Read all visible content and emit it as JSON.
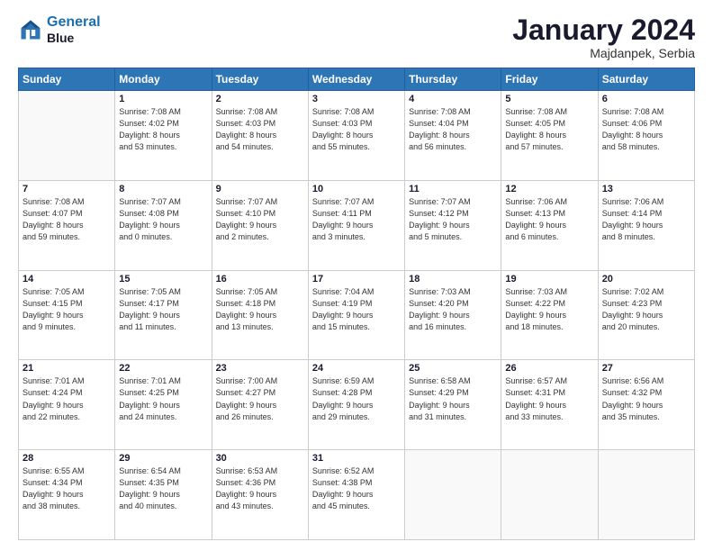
{
  "header": {
    "logo_line1": "General",
    "logo_line2": "Blue",
    "month_title": "January 2024",
    "location": "Majdanpek, Serbia"
  },
  "weekdays": [
    "Sunday",
    "Monday",
    "Tuesday",
    "Wednesday",
    "Thursday",
    "Friday",
    "Saturday"
  ],
  "weeks": [
    [
      {
        "day": "",
        "info": ""
      },
      {
        "day": "1",
        "info": "Sunrise: 7:08 AM\nSunset: 4:02 PM\nDaylight: 8 hours\nand 53 minutes."
      },
      {
        "day": "2",
        "info": "Sunrise: 7:08 AM\nSunset: 4:03 PM\nDaylight: 8 hours\nand 54 minutes."
      },
      {
        "day": "3",
        "info": "Sunrise: 7:08 AM\nSunset: 4:03 PM\nDaylight: 8 hours\nand 55 minutes."
      },
      {
        "day": "4",
        "info": "Sunrise: 7:08 AM\nSunset: 4:04 PM\nDaylight: 8 hours\nand 56 minutes."
      },
      {
        "day": "5",
        "info": "Sunrise: 7:08 AM\nSunset: 4:05 PM\nDaylight: 8 hours\nand 57 minutes."
      },
      {
        "day": "6",
        "info": "Sunrise: 7:08 AM\nSunset: 4:06 PM\nDaylight: 8 hours\nand 58 minutes."
      }
    ],
    [
      {
        "day": "7",
        "info": "Sunrise: 7:08 AM\nSunset: 4:07 PM\nDaylight: 8 hours\nand 59 minutes."
      },
      {
        "day": "8",
        "info": "Sunrise: 7:07 AM\nSunset: 4:08 PM\nDaylight: 9 hours\nand 0 minutes."
      },
      {
        "day": "9",
        "info": "Sunrise: 7:07 AM\nSunset: 4:10 PM\nDaylight: 9 hours\nand 2 minutes."
      },
      {
        "day": "10",
        "info": "Sunrise: 7:07 AM\nSunset: 4:11 PM\nDaylight: 9 hours\nand 3 minutes."
      },
      {
        "day": "11",
        "info": "Sunrise: 7:07 AM\nSunset: 4:12 PM\nDaylight: 9 hours\nand 5 minutes."
      },
      {
        "day": "12",
        "info": "Sunrise: 7:06 AM\nSunset: 4:13 PM\nDaylight: 9 hours\nand 6 minutes."
      },
      {
        "day": "13",
        "info": "Sunrise: 7:06 AM\nSunset: 4:14 PM\nDaylight: 9 hours\nand 8 minutes."
      }
    ],
    [
      {
        "day": "14",
        "info": "Sunrise: 7:05 AM\nSunset: 4:15 PM\nDaylight: 9 hours\nand 9 minutes."
      },
      {
        "day": "15",
        "info": "Sunrise: 7:05 AM\nSunset: 4:17 PM\nDaylight: 9 hours\nand 11 minutes."
      },
      {
        "day": "16",
        "info": "Sunrise: 7:05 AM\nSunset: 4:18 PM\nDaylight: 9 hours\nand 13 minutes."
      },
      {
        "day": "17",
        "info": "Sunrise: 7:04 AM\nSunset: 4:19 PM\nDaylight: 9 hours\nand 15 minutes."
      },
      {
        "day": "18",
        "info": "Sunrise: 7:03 AM\nSunset: 4:20 PM\nDaylight: 9 hours\nand 16 minutes."
      },
      {
        "day": "19",
        "info": "Sunrise: 7:03 AM\nSunset: 4:22 PM\nDaylight: 9 hours\nand 18 minutes."
      },
      {
        "day": "20",
        "info": "Sunrise: 7:02 AM\nSunset: 4:23 PM\nDaylight: 9 hours\nand 20 minutes."
      }
    ],
    [
      {
        "day": "21",
        "info": "Sunrise: 7:01 AM\nSunset: 4:24 PM\nDaylight: 9 hours\nand 22 minutes."
      },
      {
        "day": "22",
        "info": "Sunrise: 7:01 AM\nSunset: 4:25 PM\nDaylight: 9 hours\nand 24 minutes."
      },
      {
        "day": "23",
        "info": "Sunrise: 7:00 AM\nSunset: 4:27 PM\nDaylight: 9 hours\nand 26 minutes."
      },
      {
        "day": "24",
        "info": "Sunrise: 6:59 AM\nSunset: 4:28 PM\nDaylight: 9 hours\nand 29 minutes."
      },
      {
        "day": "25",
        "info": "Sunrise: 6:58 AM\nSunset: 4:29 PM\nDaylight: 9 hours\nand 31 minutes."
      },
      {
        "day": "26",
        "info": "Sunrise: 6:57 AM\nSunset: 4:31 PM\nDaylight: 9 hours\nand 33 minutes."
      },
      {
        "day": "27",
        "info": "Sunrise: 6:56 AM\nSunset: 4:32 PM\nDaylight: 9 hours\nand 35 minutes."
      }
    ],
    [
      {
        "day": "28",
        "info": "Sunrise: 6:55 AM\nSunset: 4:34 PM\nDaylight: 9 hours\nand 38 minutes."
      },
      {
        "day": "29",
        "info": "Sunrise: 6:54 AM\nSunset: 4:35 PM\nDaylight: 9 hours\nand 40 minutes."
      },
      {
        "day": "30",
        "info": "Sunrise: 6:53 AM\nSunset: 4:36 PM\nDaylight: 9 hours\nand 43 minutes."
      },
      {
        "day": "31",
        "info": "Sunrise: 6:52 AM\nSunset: 4:38 PM\nDaylight: 9 hours\nand 45 minutes."
      },
      {
        "day": "",
        "info": ""
      },
      {
        "day": "",
        "info": ""
      },
      {
        "day": "",
        "info": ""
      }
    ]
  ]
}
